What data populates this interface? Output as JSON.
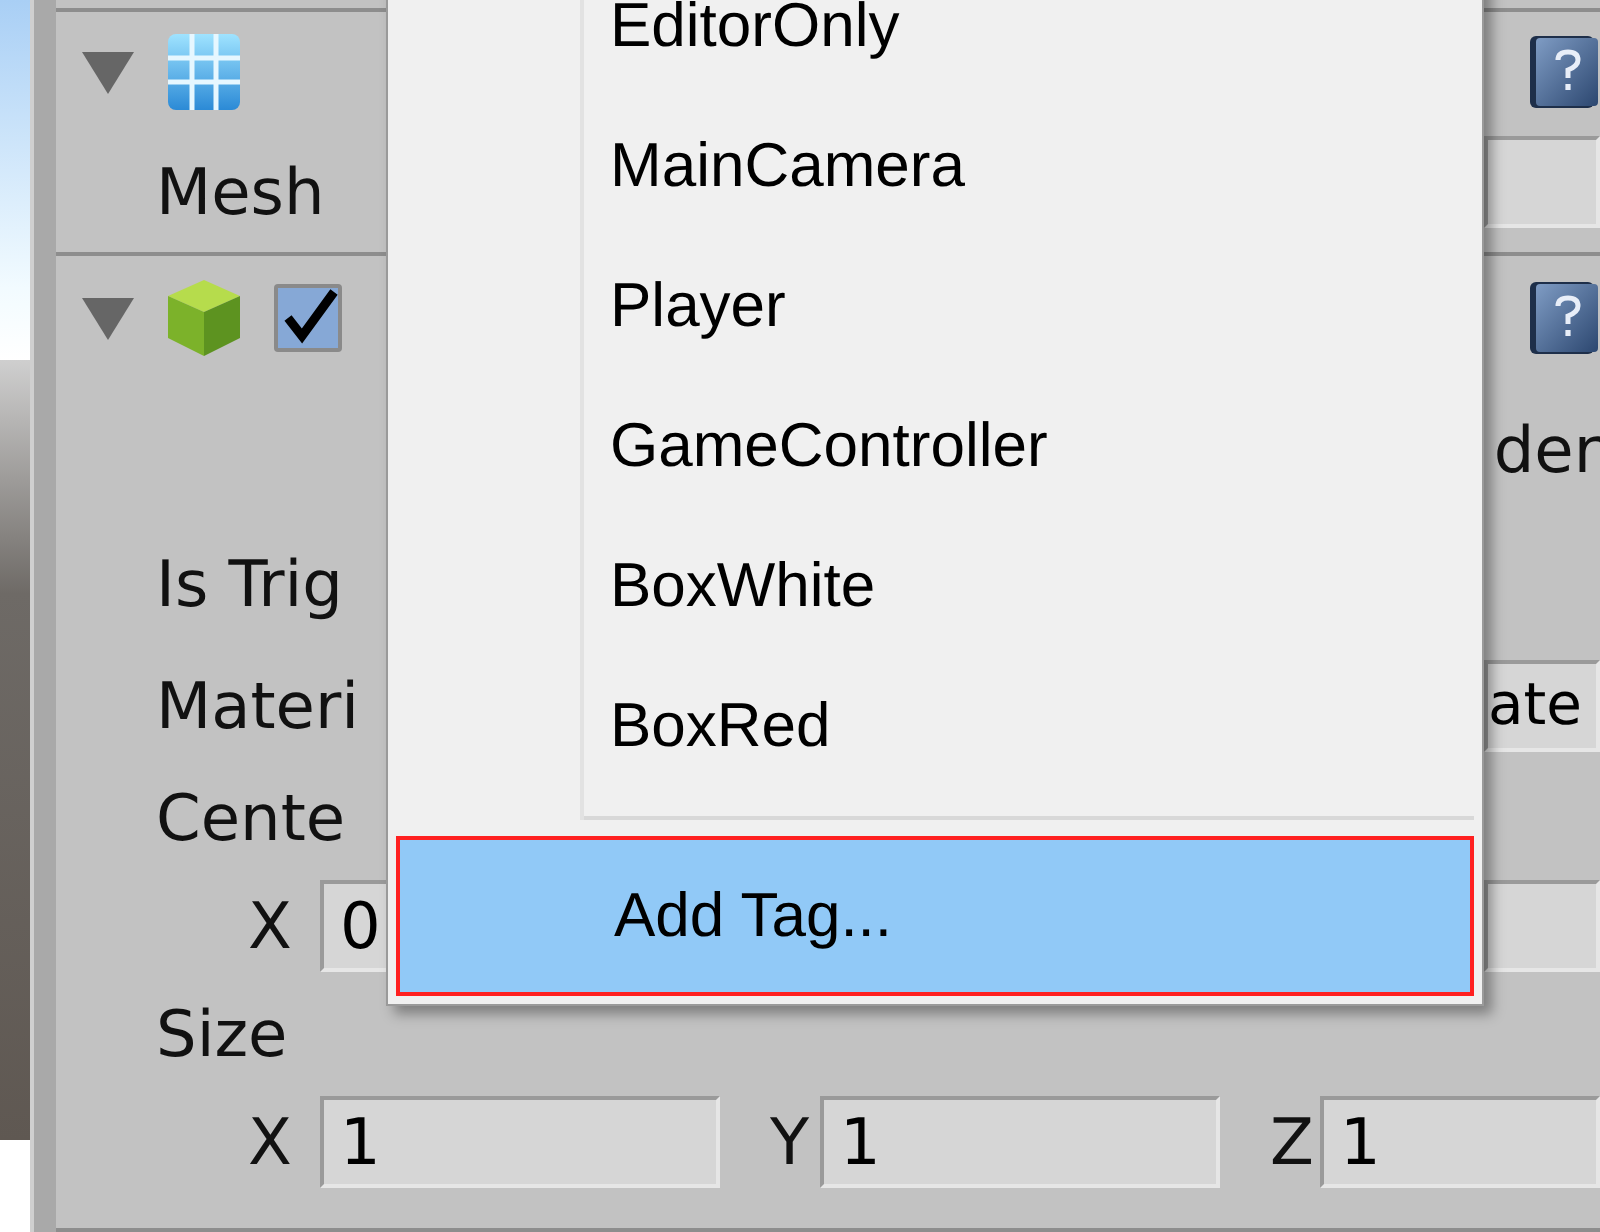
{
  "inspector": {
    "mesh_filter": {
      "expanded": true,
      "field_label": "Mesh"
    },
    "collider": {
      "expanded": true,
      "enabled": true,
      "label_fragment": "der",
      "properties": [
        {
          "kind": "toggle",
          "label": "Is Trig"
        },
        {
          "kind": "object",
          "label": "Materi",
          "value": "ate"
        },
        {
          "kind": "label",
          "label": "Cente"
        },
        {
          "kind": "vector",
          "axes": [
            {
              "label": "X",
              "value": "0"
            }
          ]
        },
        {
          "kind": "label",
          "label": "Size"
        },
        {
          "kind": "vector",
          "axes": [
            {
              "label": "X",
              "value": "1"
            },
            {
              "label": "Y",
              "value": "1"
            },
            {
              "label": "Z",
              "value": "1"
            }
          ]
        }
      ]
    }
  },
  "tag_menu": {
    "items": [
      {
        "label": "EditorOnly",
        "selected": false
      },
      {
        "label": "MainCamera",
        "selected": false
      },
      {
        "label": "Player",
        "selected": false
      },
      {
        "label": "GameController",
        "selected": false
      },
      {
        "label": "BoxWhite",
        "selected": false
      },
      {
        "label": "BoxRed",
        "selected": false
      }
    ],
    "action": {
      "label": "Add Tag...",
      "selected": true
    }
  }
}
